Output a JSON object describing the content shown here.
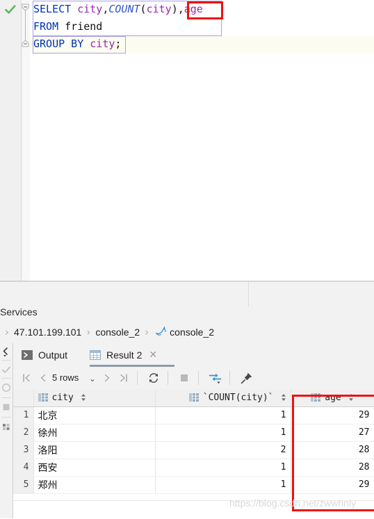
{
  "editor": {
    "gutter": {
      "run_status_icon": "green-check-icon",
      "fold_icon": "fold-minus-icon"
    },
    "lines": [
      {
        "tokens": [
          {
            "text": "SELECT",
            "type": "keyword"
          },
          {
            "text": " ",
            "type": "plain"
          },
          {
            "text": "city",
            "type": "column"
          },
          {
            "text": ",",
            "type": "punct"
          },
          {
            "text": "COUNT",
            "type": "function"
          },
          {
            "text": "(",
            "type": "punct"
          },
          {
            "text": "city",
            "type": "column"
          },
          {
            "text": ")",
            "type": "punct"
          },
          {
            "text": ",",
            "type": "punct"
          },
          {
            "text": "age",
            "type": "column"
          }
        ]
      },
      {
        "tokens": [
          {
            "text": "FROM",
            "type": "keyword"
          },
          {
            "text": " friend",
            "type": "plain"
          }
        ]
      },
      {
        "tokens": [
          {
            "text": "GROUP BY",
            "type": "keyword"
          },
          {
            "text": " ",
            "type": "plain"
          },
          {
            "text": "city",
            "type": "column"
          },
          {
            "text": ";",
            "type": "punct"
          }
        ]
      }
    ],
    "full_text": "SELECT city,COUNT(city),age\nFROM friend\nGROUP BY city;",
    "annotation_label": ",age"
  },
  "services": {
    "label": "Services"
  },
  "breadcrumb": {
    "items": [
      {
        "label": "47.101.199.101",
        "icon": null
      },
      {
        "label": "console_2",
        "icon": null
      },
      {
        "label": "console_2",
        "icon": "dolphin-icon"
      }
    ],
    "separator": "›"
  },
  "left_rail": {
    "items": [
      {
        "name": "collapse-icon"
      },
      {
        "name": "checkmark-icon"
      },
      {
        "name": "circle-icon"
      },
      {
        "name": "square-icon"
      },
      {
        "name": "grid-icon"
      }
    ]
  },
  "tabs": [
    {
      "label": "Output",
      "icon": "console-output-icon",
      "active": false,
      "closable": false
    },
    {
      "label": "Result 2",
      "icon": "table-grid-icon",
      "active": true,
      "closable": true,
      "close_glyph": "✕"
    }
  ],
  "grid_toolbar": {
    "first_page": "|‹",
    "prev_page": "‹",
    "rows_label": "5 rows",
    "rows_dropdown_glyph": "⌄",
    "next_page": "›",
    "last_page": "›|",
    "reload_icon": "refresh-icon",
    "stop_icon": "stop-icon",
    "transpose_icon": "transpose-icon",
    "pin_icon": "pin-icon"
  },
  "result_grid": {
    "columns": [
      {
        "key": "rownum",
        "label": "",
        "icon": null,
        "sortable": false
      },
      {
        "key": "city",
        "label": "city",
        "icon": "column-icon",
        "sortable": true
      },
      {
        "key": "count",
        "label": "`COUNT(city)`",
        "icon": "column-icon",
        "sortable": true
      },
      {
        "key": "age",
        "label": "age",
        "icon": "column-icon",
        "sortable": true
      }
    ],
    "rows": [
      {
        "rownum": "1",
        "city": "北京",
        "count": "1",
        "age": "29"
      },
      {
        "rownum": "2",
        "city": "徐州",
        "count": "1",
        "age": "27"
      },
      {
        "rownum": "3",
        "city": "洛阳",
        "count": "2",
        "age": "28"
      },
      {
        "rownum": "4",
        "city": "西安",
        "count": "1",
        "age": "28"
      },
      {
        "rownum": "5",
        "city": "郑州",
        "count": "1",
        "age": "29"
      }
    ],
    "row_count": 5
  },
  "watermark": {
    "text": "https://blog.csdn.net/zwwhnly"
  },
  "colors": {
    "annotation_red": "#ee1111",
    "keyword_blue": "#0033b3",
    "column_purple": "#9c27b0",
    "function_blue": "#3355cc",
    "success_green": "#4caf50",
    "accent_blue": "#3592d4",
    "panel_bg": "#f2f2f2",
    "scope_outline": "#a9a0e8"
  }
}
